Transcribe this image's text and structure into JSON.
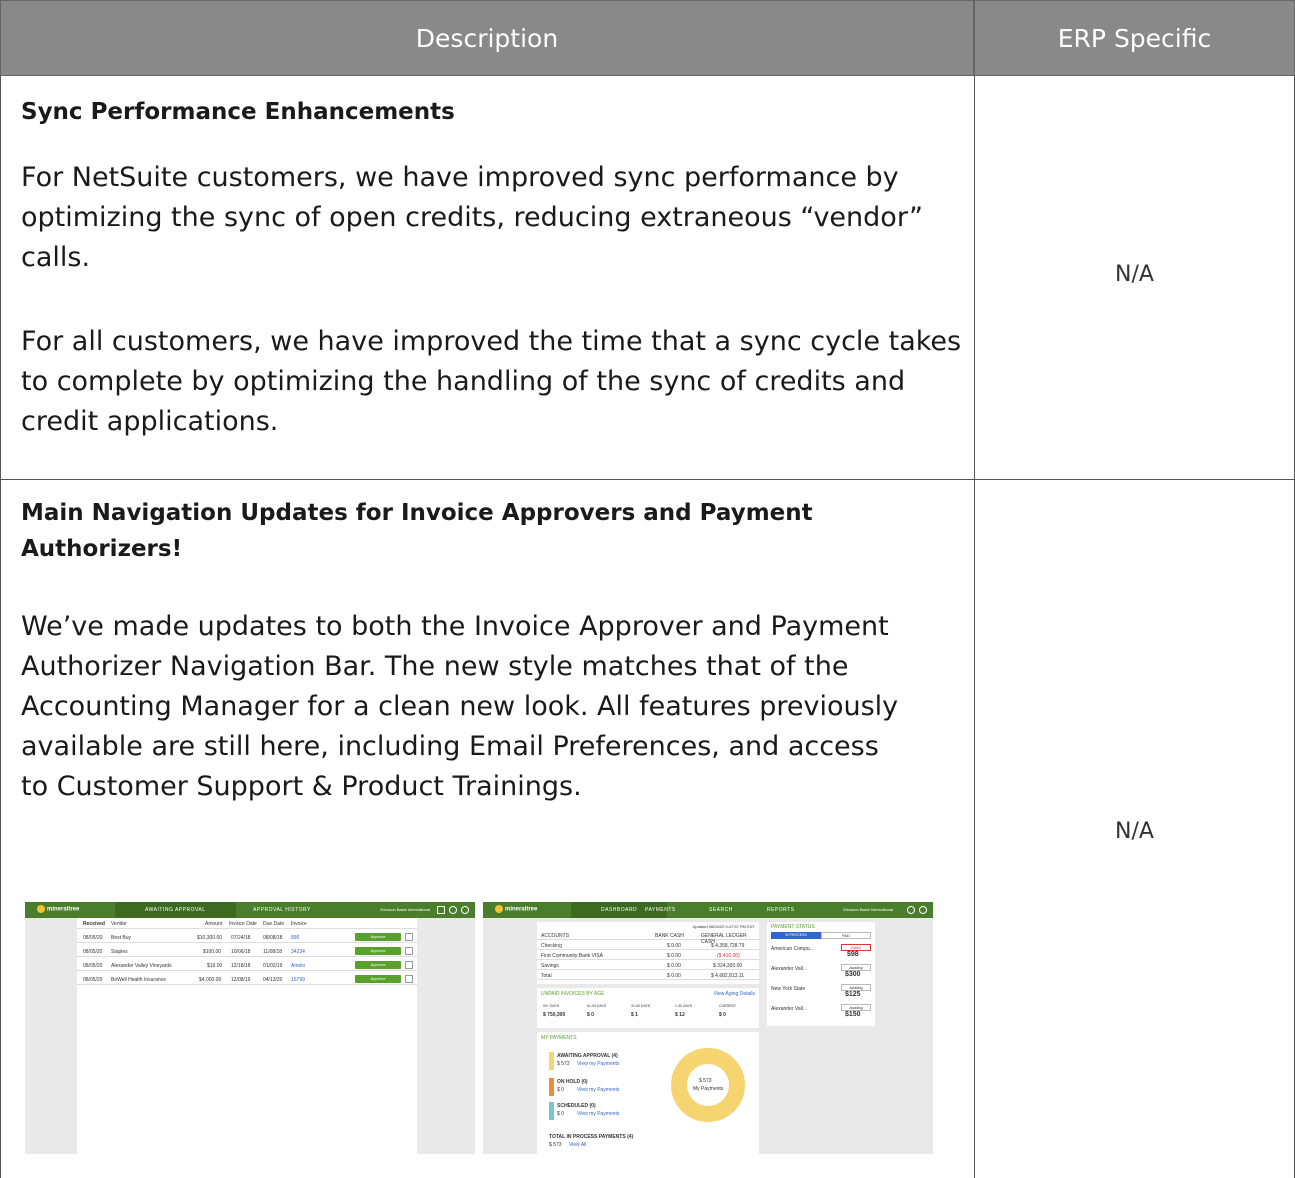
{
  "table": {
    "headers": {
      "description": "Description",
      "erp": "ERP Specific"
    },
    "rows": [
      {
        "title": "Sync Performance Enhancements",
        "paragraphs": [
          "For NetSuite customers, we have improved sync performance by optimizing the sync of open credits, reducing extraneous “vendor” calls.",
          "For all customers, we have improved the time that a sync cycle takes to complete by optimizing the handling of the sync of credits and credit applications."
        ],
        "erp": "N/A"
      },
      {
        "title": "Main Navigation Updates for Invoice Approvers and Payment Authorizers!",
        "paragraphs": [
          "We’ve made updates to both the Invoice Approver and Payment Authorizer Navigation Bar. The new style matches that of the Accounting Manager for a clean new look. All features previously available are still here, including Email Preferences, and access to Customer Support & Product Trainings."
        ],
        "erp": "N/A"
      }
    ]
  },
  "screenshot_a": {
    "logo": "mineraltree",
    "tabs": [
      "AWAITING APPROVAL",
      "APPROVAL HISTORY"
    ],
    "company": "Ericsson Basin International",
    "columns": [
      "Received",
      "Vendor",
      "Amount",
      "Invoice Date",
      "Due Date",
      "Invoice"
    ],
    "rows": [
      [
        "08/05/20",
        "Best Buy",
        "$10,300.00",
        "07/24/18",
        "08/08/18",
        "890"
      ],
      [
        "08/05/20",
        "Staples",
        "$100.00",
        "10/06/18",
        "11/08/18",
        "34234"
      ],
      [
        "08/05/20",
        "Alexander Valley Vineyards",
        "$19.00",
        "12/18/18",
        "01/02/19",
        "Amelo"
      ],
      [
        "08/05/20",
        "BeWell Health Insurance",
        "$4,000.00",
        "12/08/19",
        "04/13/20",
        "15799"
      ]
    ],
    "approve_label": "Approve"
  },
  "screenshot_b": {
    "logo": "mineraltree",
    "tabs": [
      "DASHBOARD",
      "PAYMENTS",
      "SEARCH",
      "REPORTS"
    ],
    "company": "Ericsson Basin International",
    "updated": "Updated 08/04/20 9:47:57 PM EDT",
    "accounts_header": [
      "ACCOUNTS",
      "BANK CASH",
      "GENERAL LEDGER CASH"
    ],
    "accounts": [
      [
        "Checking",
        "$ 0.00",
        "$ 4,358,728.79"
      ],
      [
        "First Community Bank VISA",
        "$ 0.00",
        "($ 410.00)"
      ],
      [
        "Savings",
        "$ 0.00",
        "$ 324,300.00"
      ],
      [
        "Total",
        "$ 0.00",
        "$ 4,682,813.11"
      ]
    ],
    "aging_title": "UNPAID INVOICES BY AGE",
    "aging_link": "View Aging Details",
    "aging": [
      [
        "90+ DAYS",
        "$ 750,300"
      ],
      [
        "61-90 DAYS",
        "$ 0"
      ],
      [
        "31-60 DAYS",
        "$ 1"
      ],
      [
        "1-30 DAYS",
        "$ 12"
      ],
      [
        "CURRENT",
        "$ 0"
      ]
    ],
    "my_payments": "MY PAYMENTS",
    "payment_groups": [
      {
        "label": "AWAITING APPROVAL (4)",
        "amount": "$ 573",
        "link": "View my Payments",
        "color": "#f6d470"
      },
      {
        "label": "ON HOLD (0)",
        "amount": "$ 0",
        "link": "View my Payments",
        "color": "#e69138"
      },
      {
        "label": "SCHEDULED (0)",
        "amount": "$ 0",
        "link": "View my Payments",
        "color": "#76c5d4"
      }
    ],
    "donut_amount": "$ 573",
    "donut_label": "My Payments",
    "total_label": "TOTAL IN PROCESS PAYMENTS (4)",
    "total_amount": "$ 573",
    "total_link": "View All",
    "status_title": "PAYMENT STATUS",
    "status_tabs": [
      "IN PROCESS",
      "PAID"
    ],
    "status_items": [
      {
        "name": "American Compu...",
        "badge": "Failed",
        "amount": "$98"
      },
      {
        "name": "Alexander Vall...",
        "badge": "Awaiting",
        "amount": "$300"
      },
      {
        "name": "New York State",
        "badge": "Awaiting",
        "amount": "$125"
      },
      {
        "name": "Alexander Vall...",
        "badge": "Awaiting",
        "amount": "$150"
      }
    ]
  }
}
